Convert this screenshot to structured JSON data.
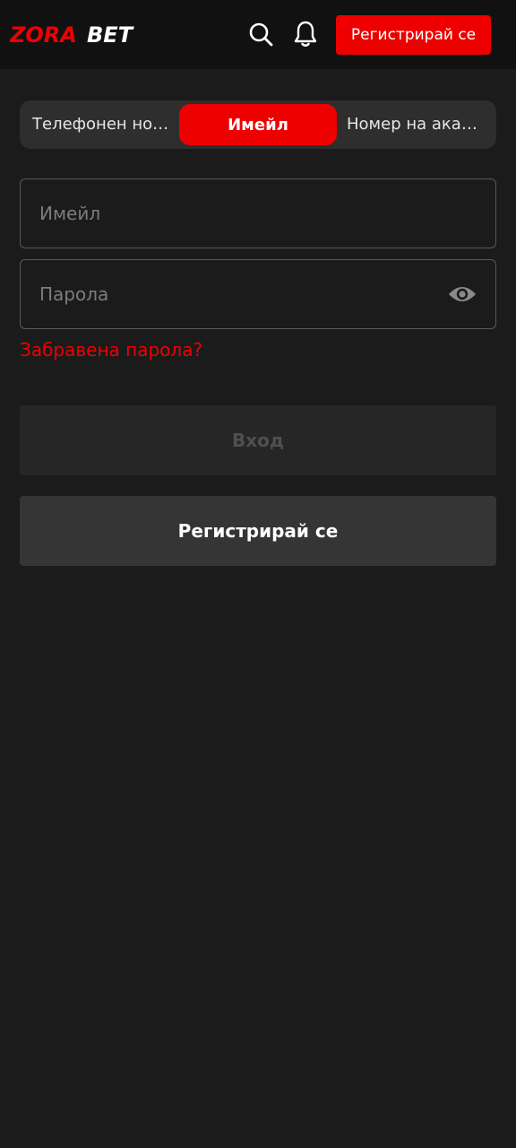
{
  "header": {
    "logo_text_part1": "ZORA",
    "logo_text_part2": "BET",
    "search_icon": "search-icon",
    "bell_icon": "bell-icon",
    "register_label": "Регистрирай се"
  },
  "tabs": [
    {
      "label": "Телефонен номер",
      "active": false
    },
    {
      "label": "Имейл",
      "active": true
    },
    {
      "label": "Номер на акаунт",
      "active": false
    }
  ],
  "form": {
    "email_placeholder": "Имейл",
    "email_value": "",
    "password_placeholder": "Парола",
    "password_value": "",
    "eye_icon": "eye-icon",
    "forgot_label": "Забравена парола?",
    "login_label": "Вход",
    "register_label": "Регистрирай се"
  },
  "colors": {
    "accent": "#ee0000",
    "background": "#1b1b1b",
    "header": "#111111"
  }
}
